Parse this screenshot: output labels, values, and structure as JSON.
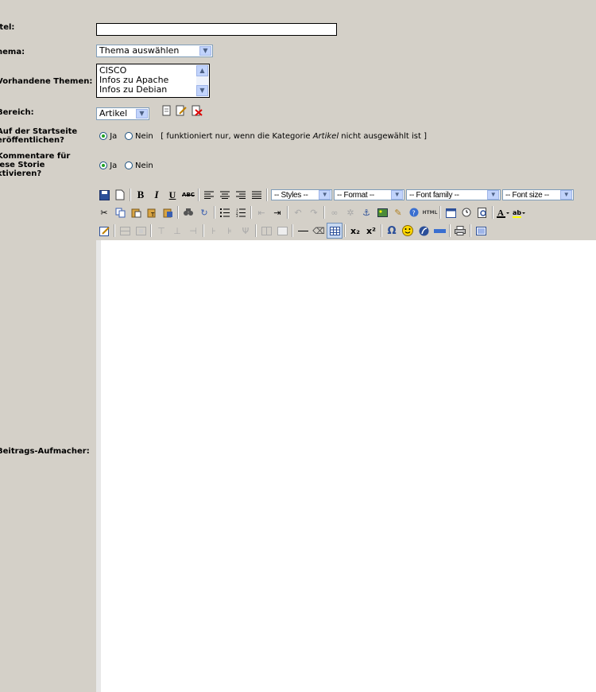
{
  "labels": {
    "titel": "itel:",
    "thema": "hema:",
    "vorhandene": "Vorhandene Themen:",
    "bereich": "Bereich:",
    "startseite_1": "Auf der Startseite",
    "startseite_2": "eröffentlichen?",
    "kommentare_1": "Kommentare für",
    "kommentare_2": "iese Storie",
    "kommentare_3": "ktivieren?",
    "aufmacher": "Beitrags-Aufmacher:"
  },
  "titel_value": "",
  "thema_select": "Thema auswählen",
  "themen_list": [
    "CISCO",
    "Infos zu Apache",
    "Infos zu Debian"
  ],
  "bereich_select": "Artikel",
  "radio": {
    "ja": "Ja",
    "nein": "Nein",
    "hint_pre": "[ funktioniert nur, wenn die Kategorie ",
    "hint_em": "Artikel",
    "hint_post": " nicht ausgewählt ist ]"
  },
  "toolbar": {
    "styles": "-- Styles --",
    "format": "-- Format --",
    "font_family": "-- Font family --",
    "font_size": "-- Font size --",
    "bold": "B",
    "italic": "I",
    "underline": "U",
    "strike": "ABC",
    "html": "HTML",
    "sub": "x₂",
    "sup": "x²",
    "omega": "Ω"
  }
}
